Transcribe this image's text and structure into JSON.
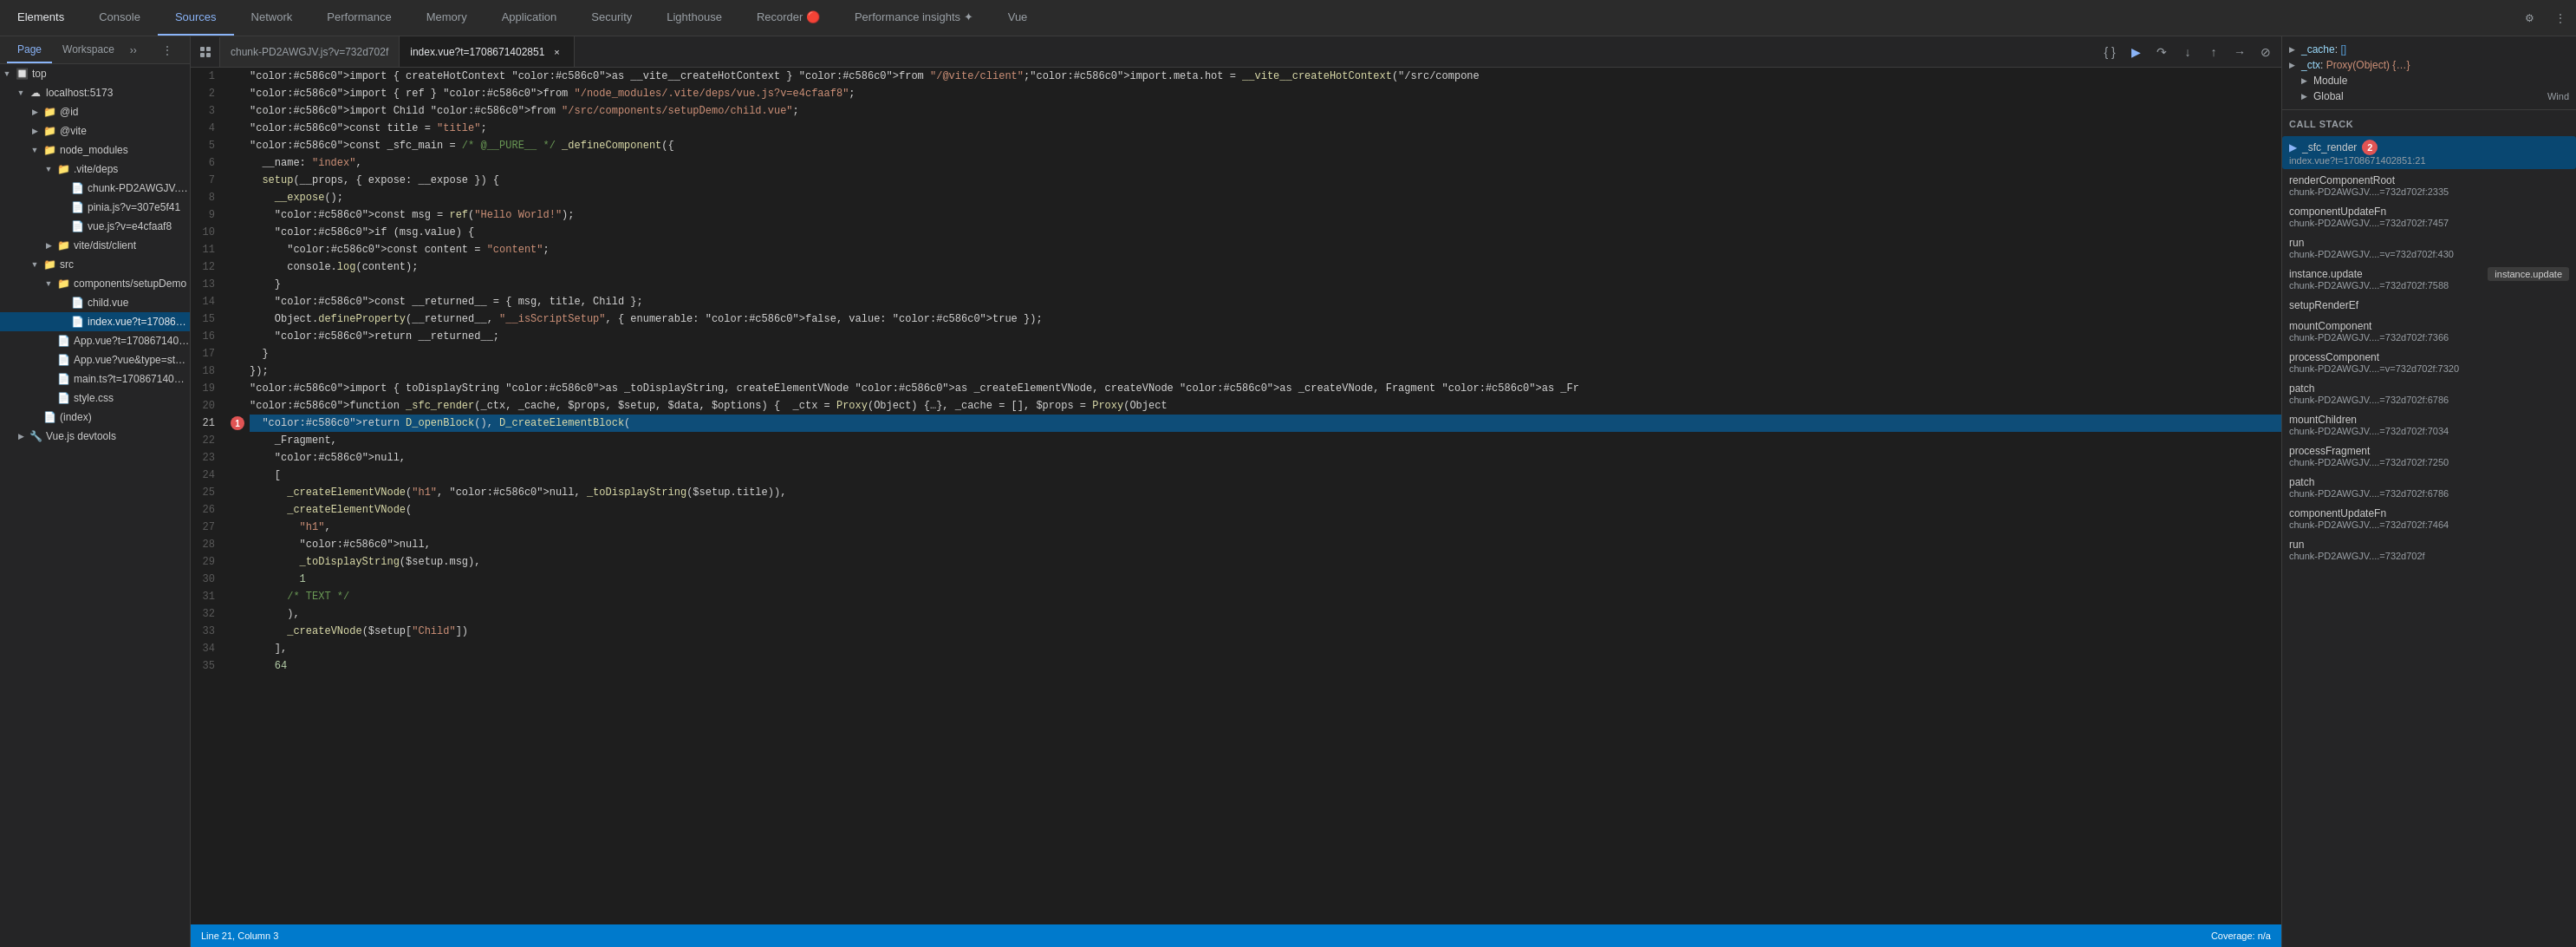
{
  "topNav": {
    "tabs": [
      {
        "id": "elements",
        "label": "Elements",
        "active": false
      },
      {
        "id": "console",
        "label": "Console",
        "active": false
      },
      {
        "id": "sources",
        "label": "Sources",
        "active": true
      },
      {
        "id": "network",
        "label": "Network",
        "active": false
      },
      {
        "id": "performance",
        "label": "Performance",
        "active": false
      },
      {
        "id": "memory",
        "label": "Memory",
        "active": false
      },
      {
        "id": "application",
        "label": "Application",
        "active": false
      },
      {
        "id": "security",
        "label": "Security",
        "active": false
      },
      {
        "id": "lighthouse",
        "label": "Lighthouse",
        "active": false
      },
      {
        "id": "recorder",
        "label": "Recorder 🔴",
        "active": false
      },
      {
        "id": "performance-insights",
        "label": "Performance insights ✦",
        "active": false
      },
      {
        "id": "vue",
        "label": "Vue",
        "active": false
      }
    ]
  },
  "subNav": {
    "tabs": [
      {
        "id": "page",
        "label": "Page",
        "active": true
      },
      {
        "id": "workspace",
        "label": "Workspace",
        "active": false
      }
    ]
  },
  "fileTabs": {
    "tabs": [
      {
        "id": "chunk",
        "label": "chunk-PD2AWGJV.js?v=732d702f",
        "active": false,
        "closeable": false
      },
      {
        "id": "index-vue",
        "label": "index.vue?t=1708671402851",
        "active": true,
        "closeable": true
      }
    ]
  },
  "sidebar": {
    "tree": [
      {
        "id": "top",
        "label": "top",
        "indent": 0,
        "type": "folder",
        "expanded": true
      },
      {
        "id": "localhost",
        "label": "localhost:5173",
        "indent": 1,
        "type": "server",
        "expanded": true
      },
      {
        "id": "id",
        "label": "@id",
        "indent": 2,
        "type": "folder",
        "expanded": false
      },
      {
        "id": "vite",
        "label": "@vite",
        "indent": 2,
        "type": "folder",
        "expanded": false
      },
      {
        "id": "node_modules",
        "label": "node_modules",
        "indent": 2,
        "type": "folder",
        "expanded": true
      },
      {
        "id": "vite-deps",
        "label": ".vite/deps",
        "indent": 3,
        "type": "folder",
        "expanded": true
      },
      {
        "id": "chunk-file",
        "label": "chunk-PD2AWGJV.js?v=7...",
        "indent": 4,
        "type": "file"
      },
      {
        "id": "pinia",
        "label": "pinia.js?v=307e5f41",
        "indent": 4,
        "type": "file"
      },
      {
        "id": "vue-js",
        "label": "vue.js?v=e4cfaaf8",
        "indent": 4,
        "type": "file"
      },
      {
        "id": "vite-dist",
        "label": "vite/dist/client",
        "indent": 3,
        "type": "folder",
        "expanded": false
      },
      {
        "id": "src",
        "label": "src",
        "indent": 2,
        "type": "folder",
        "expanded": true
      },
      {
        "id": "components-setup",
        "label": "components/setupDemo",
        "indent": 3,
        "type": "folder",
        "expanded": true
      },
      {
        "id": "child-vue",
        "label": "child.vue",
        "indent": 4,
        "type": "file"
      },
      {
        "id": "index-vue-tree",
        "label": "index.vue?t=1708671402...",
        "indent": 4,
        "type": "file",
        "selected": true
      },
      {
        "id": "app-vue",
        "label": "App.vue?t=1708671402851",
        "indent": 3,
        "type": "file"
      },
      {
        "id": "app-vue-style",
        "label": "App.vue?vue&type=style&ir...",
        "indent": 3,
        "type": "file"
      },
      {
        "id": "main-ts",
        "label": "main.ts?t=1708671402851",
        "indent": 3,
        "type": "file"
      },
      {
        "id": "style-css",
        "label": "style.css",
        "indent": 3,
        "type": "file"
      },
      {
        "id": "index-html",
        "label": "(index)",
        "indent": 2,
        "type": "file"
      },
      {
        "id": "vue-devtools",
        "label": "Vue.js devtools",
        "indent": 1,
        "type": "folder",
        "expanded": false
      }
    ]
  },
  "code": {
    "filename": "index.vue?t=1708671402851",
    "currentLine": 21,
    "lines": [
      {
        "n": 1,
        "text": "import { createHotContext as __vite__createHotContext } from \"/@vite/client\";import.meta.hot = __vite__createHotContext(\"/src/compone"
      },
      {
        "n": 2,
        "text": "import { ref } from \"/node_modules/.vite/deps/vue.js?v=e4cfaaf8\";"
      },
      {
        "n": 3,
        "text": "import Child from \"/src/components/setupDemo/child.vue\";"
      },
      {
        "n": 4,
        "text": "const title = \"title\";"
      },
      {
        "n": 5,
        "text": "const _sfc_main = /* @__PURE__ */ _defineComponent({"
      },
      {
        "n": 6,
        "text": "  __name: \"index\","
      },
      {
        "n": 7,
        "text": "  setup(__props, { expose: __expose }) {"
      },
      {
        "n": 8,
        "text": "    __expose();"
      },
      {
        "n": 9,
        "text": "    const msg = ref(\"Hello World!\");"
      },
      {
        "n": 10,
        "text": "    if (msg.value) {"
      },
      {
        "n": 11,
        "text": "      const content = \"content\";"
      },
      {
        "n": 12,
        "text": "      console.log(content);"
      },
      {
        "n": 13,
        "text": "    }"
      },
      {
        "n": 14,
        "text": "    const __returned__ = { msg, title, Child };"
      },
      {
        "n": 15,
        "text": "    Object.defineProperty(__returned__, \"__isScriptSetup\", { enumerable: false, value: true });"
      },
      {
        "n": 16,
        "text": "    return __returned__;"
      },
      {
        "n": 17,
        "text": "  }"
      },
      {
        "n": 18,
        "text": "});"
      },
      {
        "n": 19,
        "text": "import { toDisplayString as _toDisplayString, createElementVNode as _createElementVNode, createVNode as _createVNode, Fragment as _Fr"
      },
      {
        "n": 20,
        "text": "function _sfc_render(_ctx, _cache, $props, $setup, $data, $options) {  _ctx = Proxy(Object) {…}, _cache = [], $props = Proxy(Object"
      },
      {
        "n": 21,
        "text": "  return D_openBlock(), D_createElementBlock(",
        "current": true,
        "breakpoint": true,
        "breakpointNum": 1
      },
      {
        "n": 22,
        "text": "    _Fragment,"
      },
      {
        "n": 23,
        "text": "    null,"
      },
      {
        "n": 24,
        "text": "    ["
      },
      {
        "n": 25,
        "text": "      _createElementVNode(\"h1\", null, _toDisplayString($setup.title)),"
      },
      {
        "n": 26,
        "text": "      _createElementVNode("
      },
      {
        "n": 27,
        "text": "        \"h1\","
      },
      {
        "n": 28,
        "text": "        null,"
      },
      {
        "n": 29,
        "text": "        _toDisplayString($setup.msg),"
      },
      {
        "n": 30,
        "text": "        1"
      },
      {
        "n": 31,
        "text": "      /* TEXT */"
      },
      {
        "n": 32,
        "text": "      ),"
      },
      {
        "n": 33,
        "text": "      _createVNode($setup[\"Child\"])"
      },
      {
        "n": 34,
        "text": "    ],"
      },
      {
        "n": 35,
        "text": "    64"
      }
    ]
  },
  "rightPanel": {
    "scopeSection": {
      "header": "",
      "items": [
        {
          "key": "_cache",
          "value": "[]",
          "type": "array",
          "expandable": true
        },
        {
          "key": "_ctx",
          "value": "Proxy(Object) {…}",
          "type": "proxy",
          "expandable": true
        }
      ],
      "subItems": [
        {
          "label": "Module",
          "expandable": true
        },
        {
          "label": "Global",
          "expandable": true,
          "suffix": "Wind"
        }
      ]
    },
    "callStack": {
      "header": "Call Stack",
      "items": [
        {
          "fn": "_sfc_render",
          "file": "index.vue?t=1708671402851:21",
          "badge": 2,
          "active": true
        },
        {
          "fn": "renderComponentRoot",
          "file": "chunk-PD2AWGJV....=732d702f:2335"
        },
        {
          "fn": "componentUpdateFn",
          "file": "chunk-PD2AWGJV....=732d702f:7457"
        },
        {
          "fn": "run",
          "file": "chunk-PD2AWGJV....=v=732d702f:430"
        },
        {
          "fn": "instance.update",
          "file": "chunk-PD2AWGJV....=732d702f:7588",
          "tooltip": "instance.update"
        },
        {
          "fn": "setupRenderEf",
          "file": ""
        },
        {
          "fn": "mountComponent",
          "file": "chunk-PD2AWGJV....=732d702f:7366"
        },
        {
          "fn": "processComponent",
          "file": "chunk-PD2AWGJV....=v=732d702f:7320"
        },
        {
          "fn": "patch",
          "file": "chunk-PD2AWGJV....=732d702f:6786"
        },
        {
          "fn": "mountChildren",
          "file": "chunk-PD2AWGJV....=732d702f:7034"
        },
        {
          "fn": "processFragment",
          "file": "chunk-PD2AWGJV....=732d702f:7250"
        },
        {
          "fn": "patch",
          "file": "chunk-PD2AWGJV....=732d702f:6786 (2)"
        },
        {
          "fn": "componentUpdateFn",
          "file": "chunk-PD2AWGJV....=732d702f:7464"
        },
        {
          "fn": "run",
          "file": "chunk-PD2AWGJV....=732d702f"
        }
      ]
    }
  },
  "statusBar": {
    "position": "Line 21, Column 3",
    "coverage": "Coverage: n/a"
  }
}
